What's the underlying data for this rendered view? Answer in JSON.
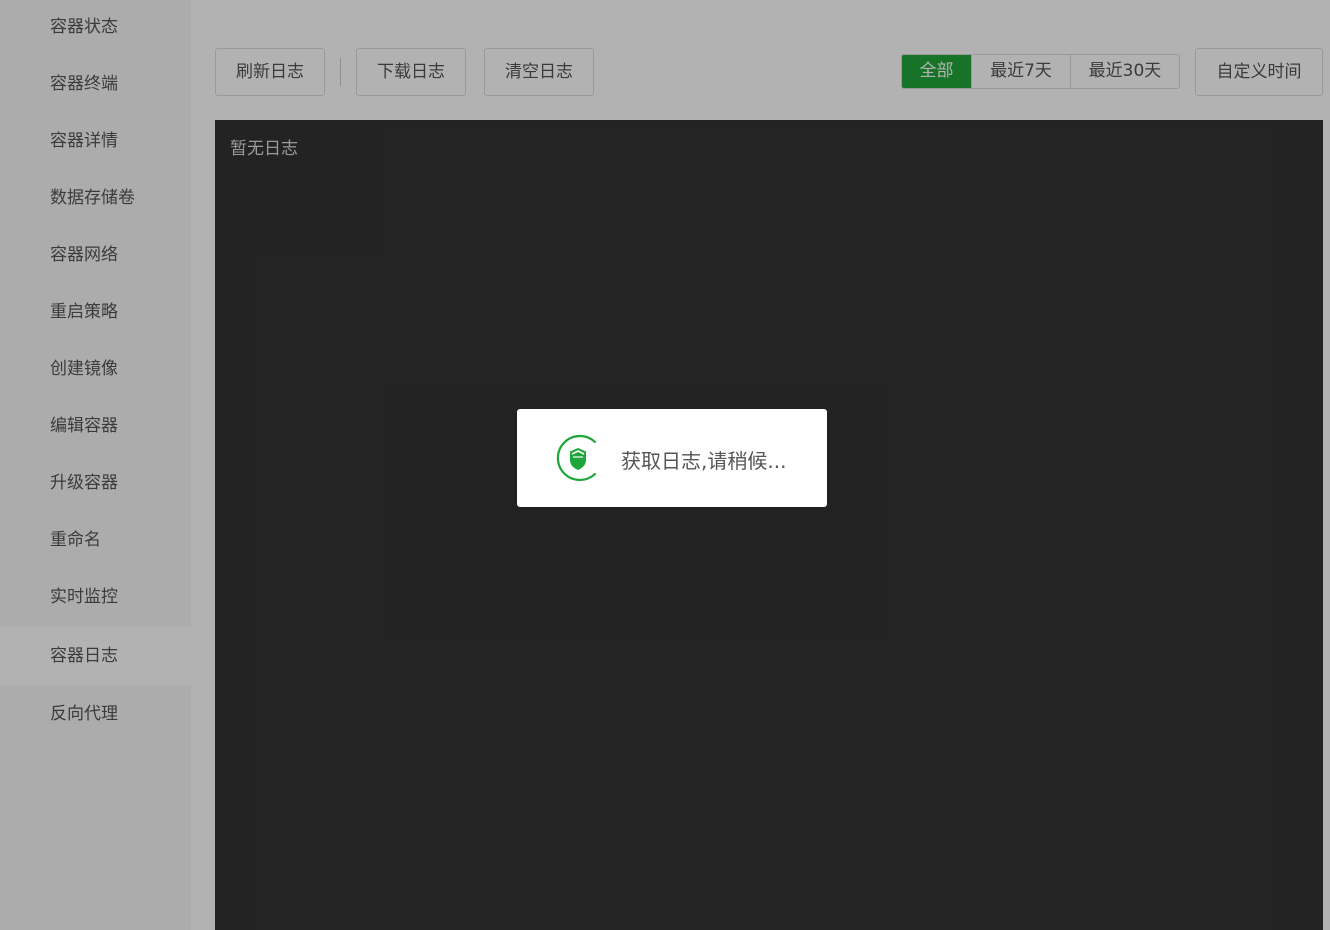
{
  "sidebar": {
    "items": [
      {
        "label": "容器状态"
      },
      {
        "label": "容器终端"
      },
      {
        "label": "容器详情"
      },
      {
        "label": "数据存储卷"
      },
      {
        "label": "容器网络"
      },
      {
        "label": "重启策略"
      },
      {
        "label": "创建镜像"
      },
      {
        "label": "编辑容器"
      },
      {
        "label": "升级容器"
      },
      {
        "label": "重命名"
      },
      {
        "label": "实时监控"
      },
      {
        "label": "容器日志"
      },
      {
        "label": "反向代理"
      }
    ],
    "active_index": 11
  },
  "toolbar": {
    "refresh_label": "刷新日志",
    "download_label": "下载日志",
    "clear_label": "清空日志",
    "range": {
      "all_label": "全部",
      "last7_label": "最近7天",
      "last30_label": "最近30天",
      "selected": "全部"
    },
    "custom_time_label": "自定义时间"
  },
  "log": {
    "empty_text": "暂无日志"
  },
  "loading": {
    "text": "获取日志,请稍候...",
    "icon": "loading-shield-spinner-icon"
  },
  "colors": {
    "accent": "#20a53a",
    "log_bg": "#333333",
    "overlay": "rgba(0,0,0,0.3)"
  }
}
